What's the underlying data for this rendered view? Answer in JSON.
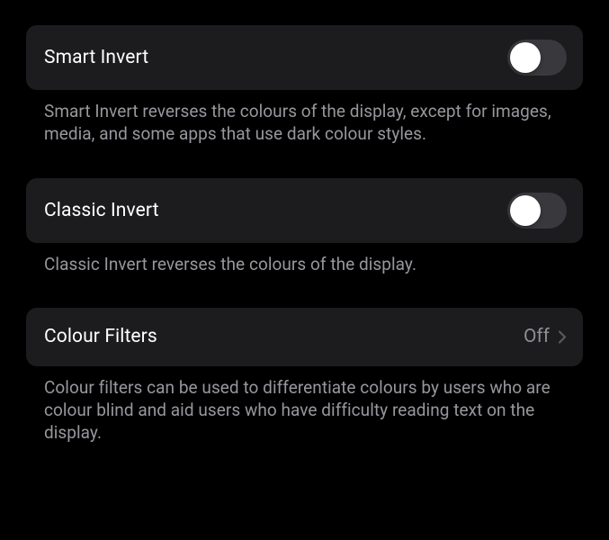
{
  "smart_invert": {
    "label": "Smart Invert",
    "value": "off",
    "desc": "Smart Invert reverses the colours of the display, except for images, media, and some apps that use dark colour styles."
  },
  "classic_invert": {
    "label": "Classic Invert",
    "value": "off",
    "desc": "Classic Invert reverses the colours of the display."
  },
  "colour_filters": {
    "label": "Colour Filters",
    "value": "Off",
    "desc": "Colour filters can be used to differentiate colours by users who are colour blind and aid users who have difficulty reading text on the display."
  }
}
